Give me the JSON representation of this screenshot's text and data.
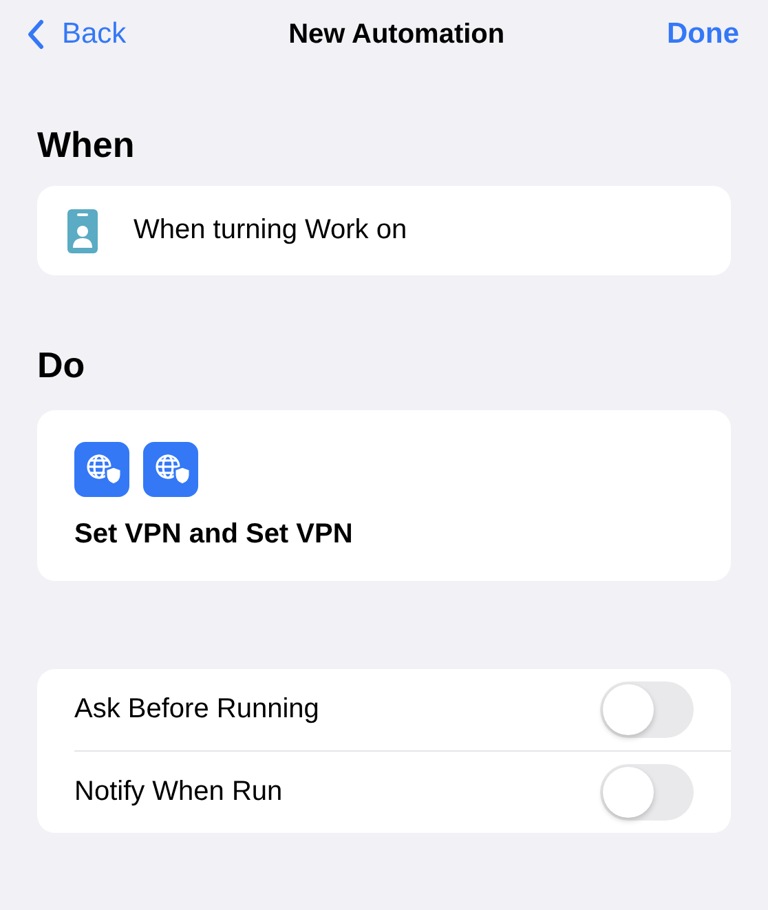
{
  "nav": {
    "back": "Back",
    "title": "New Automation",
    "done": "Done"
  },
  "when": {
    "heading": "When",
    "trigger": {
      "kind": "badge",
      "label": "When turning Work on"
    }
  },
  "do": {
    "heading": "Do",
    "actions": [
      {
        "kind": "vpn"
      },
      {
        "kind": "vpn"
      }
    ],
    "summary": "Set VPN and Set VPN"
  },
  "options": [
    {
      "label": "Ask Before Running",
      "on": false
    },
    {
      "label": "Notify When Run",
      "on": false
    }
  ]
}
